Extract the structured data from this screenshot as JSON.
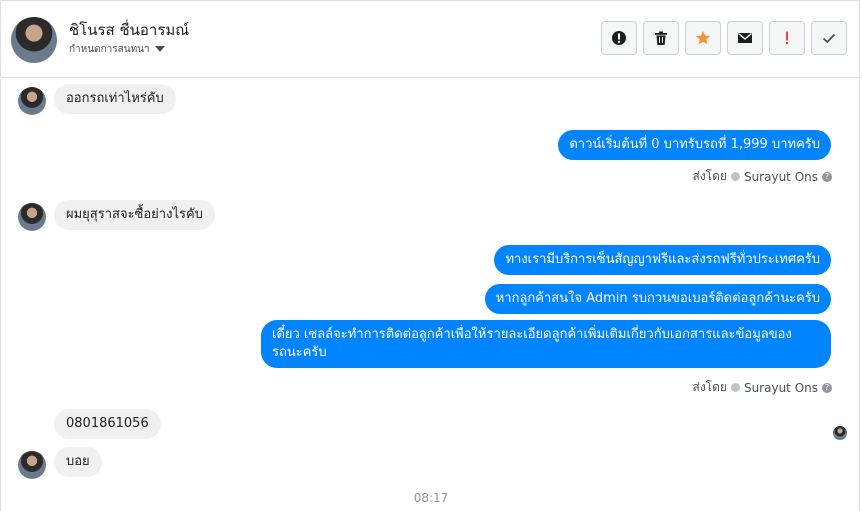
{
  "header": {
    "name": "ชิโนรส ชื่นอารมณ์",
    "subtitle": "กำหนดการสนทนา"
  },
  "toolbar": {
    "icons": [
      "alert-circle-icon",
      "trash-icon",
      "star-icon",
      "envelope-icon",
      "exclamation-icon",
      "check-icon"
    ],
    "star_color": "#f7923b",
    "exclamation_color": "#fa3e3e"
  },
  "messages": {
    "in1": "ออกรถเท่าไหร่คับ",
    "out1": "ดาวน์เริ่มต้นที่ 0 บาทรับรถที่ 1,999 บาทครับ",
    "in2": "ผมยุสุราสจะซื้อย่างไรคับ",
    "out2": "ทางเรามีบริการเซ็นสัญญาฟรีและส่งรถฟรีทั่วประเทศครับ",
    "out3": "หากลูกค้าสนใจ Admin รบกวนขอเบอร์ติดต่อลูกค้านะครับ",
    "out4_line1": "เดี๋ยว เซลล์จะทำการติดต่อลูกค้าเพื่อให้รายละเอียดลูกค้าเพิ่มเติมเกี่ยวกับเอกสารและข้อมูลของ",
    "out4_line2": "รถนะครับ",
    "in3": "0801861056",
    "in4": "บอย"
  },
  "sent_by": {
    "label": "ส่งโดย",
    "name": "Surayut Ons"
  },
  "timestamp": "08:17",
  "colors": {
    "outgoing_bubble": "#0084ff",
    "incoming_bubble": "#f1f0f0"
  }
}
